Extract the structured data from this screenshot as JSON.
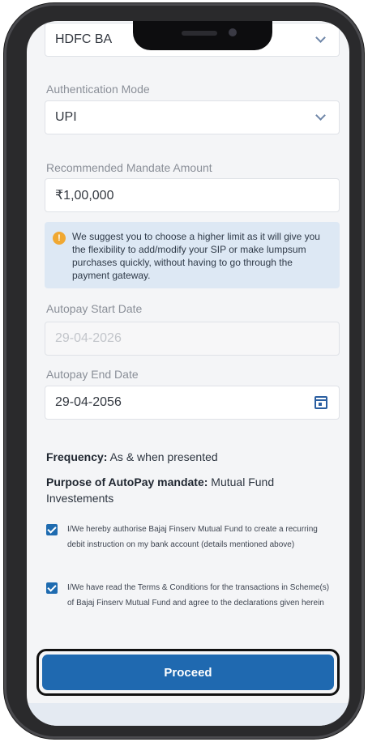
{
  "bank": {
    "value": "HDFC BA"
  },
  "auth_mode": {
    "label": "Authentication Mode",
    "value": "UPI"
  },
  "mandate_amount": {
    "label": "Recommended Mandate Amount",
    "value": "₹1,00,000"
  },
  "info": {
    "icon": "info-icon",
    "text": "We suggest you to choose a higher limit as it will give you the flexibility to add/modify your SIP or make lumpsum purchases quickly, without having to go through the payment gateway."
  },
  "start_date": {
    "label": "Autopay Start Date",
    "value": "29-04-2026"
  },
  "end_date": {
    "label": "Autopay End Date",
    "value": "29-04-2056"
  },
  "frequency": {
    "label": "Frequency:",
    "value": "As & when presented"
  },
  "purpose": {
    "label": "Purpose of AutoPay mandate:",
    "value": "Mutual Fund Investements"
  },
  "consents": [
    {
      "checked": true,
      "text": "I/We hereby authorise Bajaj Finserv Mutual Fund to create a recurring debit instruction on my bank account (details mentioned above)"
    },
    {
      "checked": true,
      "text": "I/We have read the Terms & Conditions for the transactions in Scheme(s) of Bajaj Finserv Mutual Fund and agree to the declarations given herein"
    }
  ],
  "proceed_label": "Proceed",
  "colors": {
    "primary": "#1f69b0",
    "info_bg": "#dde8f4",
    "warning": "#f0a832"
  }
}
